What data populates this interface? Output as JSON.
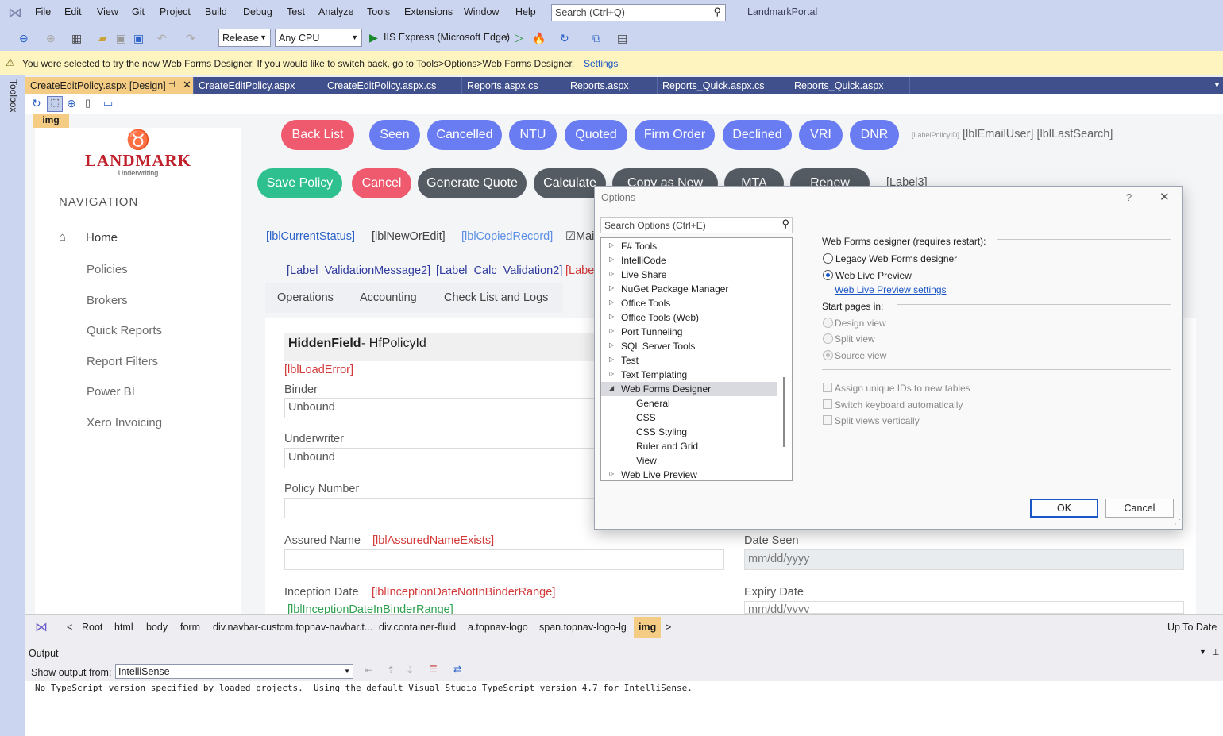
{
  "menu": {
    "items": [
      "File",
      "Edit",
      "View",
      "Git",
      "Project",
      "Build",
      "Debug",
      "Test",
      "Analyze",
      "Tools",
      "Extensions",
      "Window",
      "Help"
    ],
    "search_placeholder": "Search (Ctrl+Q)",
    "solution_name": "LandmarkPortal"
  },
  "toolbar": {
    "configuration": "Release",
    "platform": "Any CPU",
    "run_target": "IIS Express (Microsoft Edge)"
  },
  "infobar": {
    "message": "You were selected to try the new Web Forms Designer. If you would like to switch back, go to Tools>Options>Web Forms Designer.",
    "link": "Settings"
  },
  "side_tool": "Toolbox",
  "tabs": [
    "CreateEditPolicy.aspx [Design]",
    "CreateEditPolicy.aspx",
    "CreateEditPolicy.aspx.cs",
    "Reports.aspx.cs",
    "Reports.aspx",
    "Reports_Quick.aspx.cs",
    "Reports_Quick.aspx"
  ],
  "designer": {
    "img_tag": "img",
    "logo": {
      "title": "LANDMARK",
      "subtitle": "Underwriting"
    },
    "nav_heading": "NAVIGATION",
    "nav_items": [
      "Home",
      "Policies",
      "Brokers",
      "Quick Reports",
      "Report Filters",
      "Power BI",
      "Xero Invoicing"
    ],
    "status_buttons": [
      "Back List",
      "Seen",
      "Cancelled",
      "NTU",
      "Quoted",
      "Firm Order",
      "Declined",
      "VRI",
      "DNR"
    ],
    "small_label": "[LabelPolicyID]",
    "email_label": "[lblEmailUser] [lblLastSearch]",
    "action_buttons": [
      "Save Policy",
      "Cancel",
      "Generate Quote",
      "Calculate",
      "Copy as New",
      "MTA",
      "Renew"
    ],
    "label3": "[Label3]",
    "status_row": {
      "current": "[lblCurrentStatus]",
      "new_or_edit": "[lblNewOrEdit]",
      "copied": "[lblCopiedRecord]",
      "check": "Mai"
    },
    "validation": {
      "a": "[Label_ValidationMessage2]",
      "b": "[Label_Calc_Validation2]",
      "c": "[Labe"
    },
    "form_tabs": [
      "Operations",
      "Accounting",
      "Check List and Logs"
    ],
    "hidden_field": {
      "bold": "HiddenField",
      "rest": " - HfPolicyId"
    },
    "load_error": "[lblLoadError]",
    "binder": {
      "label": "Binder",
      "value": "Unbound"
    },
    "underwriter": {
      "label": "Underwriter",
      "value": "Unbound"
    },
    "policy_number": "Policy Number",
    "assured_name": {
      "label": "Assured Name",
      "error": "[lblAssuredNameExists]"
    },
    "date_seen": {
      "label": "Date Seen",
      "placeholder": "mm/dd/yyyy"
    },
    "inception": {
      "label": "Inception Date",
      "error": "[lblInceptionDateNotInBinderRange]",
      "info": "[lblInceptionDateInBinderRange]"
    },
    "expiry": {
      "label": "Expiry Date",
      "placeholder": "mm/dd/yyyy"
    }
  },
  "breadcrumb": {
    "items": [
      "Root",
      "html",
      "body",
      "form",
      "div.navbar-custom.topnav-navbar.t...",
      "div.container-fluid",
      "a.topnav-logo",
      "span.topnav-logo-lg",
      "img"
    ],
    "status": "Up To Date"
  },
  "output": {
    "title": "Output",
    "show_from_label": "Show output from:",
    "source": "IntelliSense",
    "text": "No TypeScript version specified by loaded projects.  Using the default Visual Studio TypeScript version 4.7 for IntelliSense."
  },
  "dialog": {
    "title": "Options",
    "help": "?",
    "search_placeholder": "Search Options (Ctrl+E)",
    "tree": [
      "F# Tools",
      "IntelliCode",
      "Live Share",
      "NuGet Package Manager",
      "Office Tools",
      "Office Tools (Web)",
      "Port Tunneling",
      "SQL Server Tools",
      "Test",
      "Text Templating",
      "Web Forms Designer",
      "General",
      "CSS",
      "CSS Styling",
      "Ruler and Grid",
      "View",
      "Web Live Preview"
    ],
    "section1": "Web Forms designer (requires restart):",
    "opt_legacy": "Legacy Web Forms designer",
    "opt_live": "Web Live Preview",
    "live_link": "Web Live Preview settings",
    "section2": "Start pages in:",
    "opt_design": "Design view",
    "opt_split": "Split view",
    "opt_source": "Source view",
    "chk1": "Assign unique IDs to new tables",
    "chk2": "Switch keyboard automatically",
    "chk3": "Split views vertically",
    "ok": "OK",
    "cancel": "Cancel"
  }
}
